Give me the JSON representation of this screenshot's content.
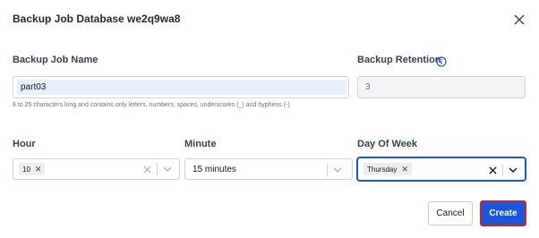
{
  "dialog": {
    "title": "Backup Job Database we2q9wa8"
  },
  "fields": {
    "job_name": {
      "label": "Backup Job Name",
      "value": "part03",
      "hint": "8 to 25 characters long and contains only letters, numbers, spaces, underscores (_) and hyphens (-)"
    },
    "retention": {
      "label": "Backup Retention",
      "value": "3",
      "info_icon": "info-icon"
    },
    "hour": {
      "label": "Hour",
      "chips": [
        "10"
      ]
    },
    "minute": {
      "label": "Minute",
      "value": "15 minutes"
    },
    "day_of_week": {
      "label": "Day Of Week",
      "chips": [
        "Thursday"
      ]
    }
  },
  "buttons": {
    "cancel": "Cancel",
    "create": "Create"
  },
  "colors": {
    "primary": "#1a56db",
    "focus_border": "#1a56db",
    "create_outline": "#c62828",
    "info": "#1a56db"
  }
}
